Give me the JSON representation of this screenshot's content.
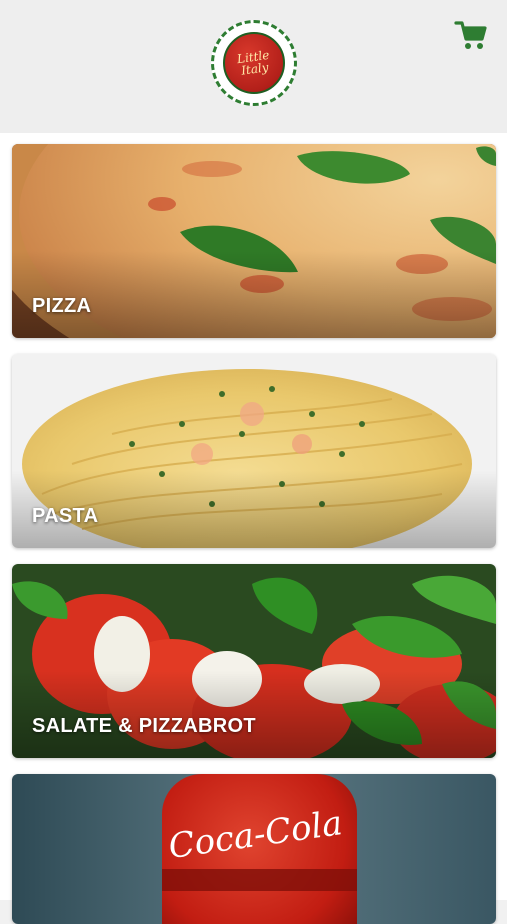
{
  "header": {
    "logo_text": "Little Italy",
    "cart_icon": "cart-icon",
    "brand_color": "#2e7d32"
  },
  "categories": [
    {
      "label": "PIZZA",
      "icon": "pizza-image"
    },
    {
      "label": "PASTA",
      "icon": "pasta-image"
    },
    {
      "label": "SALATE & PIZZABROT",
      "icon": "salad-image"
    },
    {
      "label": "",
      "icon": "coca-cola-image",
      "brand_text": "Coca-Cola"
    }
  ]
}
